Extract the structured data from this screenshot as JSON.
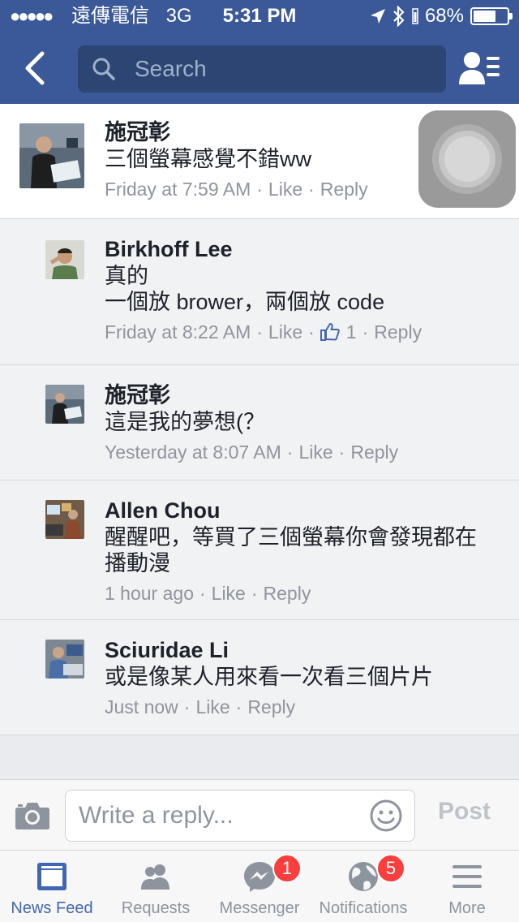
{
  "status_bar": {
    "signal": "●●●●●",
    "carrier": "遠傳電信",
    "network": "3G",
    "time": "5:31 PM",
    "battery": "68%",
    "battery_level": 0.68
  },
  "header": {
    "search_placeholder": "Search",
    "bar_color": "#3b5998"
  },
  "comments": [
    {
      "author": "施冠彰",
      "text": "三個螢幕感覺不錯ww",
      "time": "Friday at 7:59 AM",
      "like": "Like",
      "reply": "Reply",
      "is_parent": true
    },
    {
      "author": "Birkhoff Lee",
      "text": "真的\n一個放 brower，兩個放 code",
      "time": "Friday at 8:22 AM",
      "like": "Like",
      "like_count": "1",
      "reply": "Reply"
    },
    {
      "author": "施冠彰",
      "text": "這是我的夢想(？",
      "time": "Yesterday at 8:07 AM",
      "like": "Like",
      "reply": "Reply"
    },
    {
      "author": "Allen Chou",
      "text": "醒醒吧，等買了三個螢幕你會發現都在\n播動漫",
      "time": "1 hour ago",
      "like": "Like",
      "reply": "Reply"
    },
    {
      "author": "Sciuridae Li",
      "text": "或是像某人用來看一次看三個片片",
      "time": "Just now",
      "like": "Like",
      "reply": "Reply"
    }
  ],
  "composer": {
    "placeholder": "Write a reply...",
    "post_label": "Post"
  },
  "tabs": [
    {
      "label": "News Feed",
      "icon": "news-feed-icon",
      "active": true
    },
    {
      "label": "Requests",
      "icon": "friend-requests-icon"
    },
    {
      "label": "Messenger",
      "icon": "messenger-icon",
      "badge": "1"
    },
    {
      "label": "Notifications",
      "icon": "globe-icon",
      "badge": "5"
    },
    {
      "label": "More",
      "icon": "menu-icon"
    }
  ],
  "colors": {
    "accent": "#4267b2",
    "badge": "#fa3e3e",
    "meta_text": "#90949c"
  }
}
